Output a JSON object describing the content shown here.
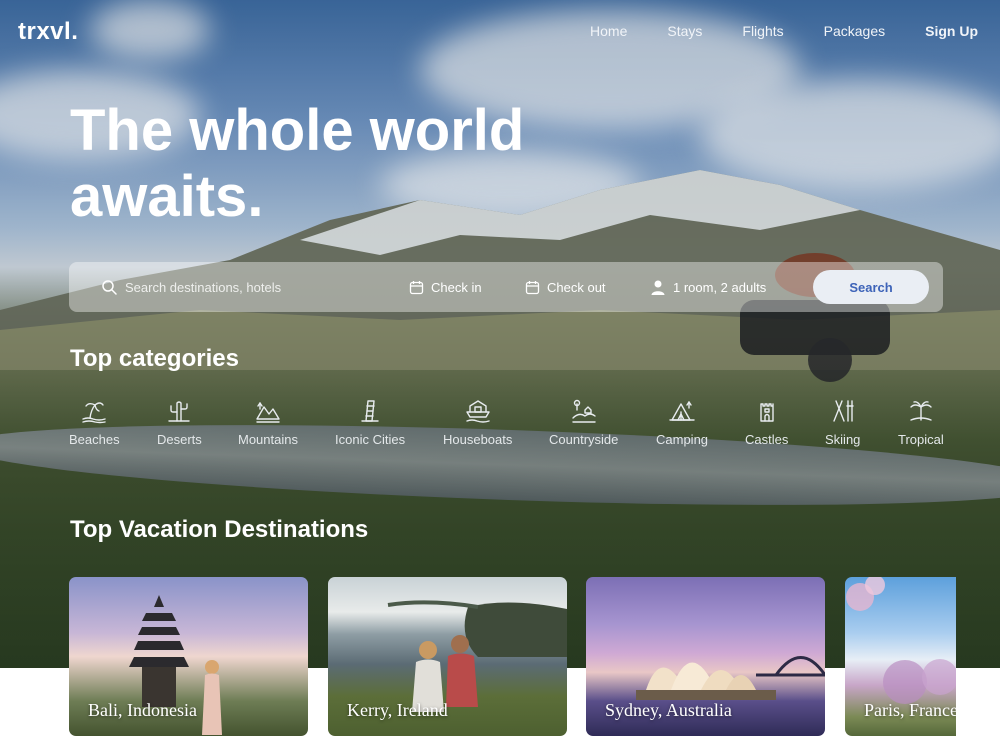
{
  "brand": {
    "logo": "trxvl."
  },
  "nav": {
    "items": [
      "Home",
      "Stays",
      "Flights",
      "Packages"
    ],
    "signup": "Sign Up"
  },
  "hero": {
    "headline": "The whole world awaits."
  },
  "search": {
    "placeholder": "Search destinations, hotels",
    "checkin": "Check in",
    "checkout": "Check out",
    "guests": "1 room, 2 adults",
    "button": "Search"
  },
  "categories": {
    "title": "Top categories",
    "items": [
      {
        "label": "Beaches",
        "icon": "beach-icon"
      },
      {
        "label": "Deserts",
        "icon": "cactus-icon"
      },
      {
        "label": "Mountains",
        "icon": "mountain-icon"
      },
      {
        "label": "Iconic Cities",
        "icon": "leaning-tower-icon"
      },
      {
        "label": "Houseboats",
        "icon": "houseboat-icon"
      },
      {
        "label": "Countryside",
        "icon": "countryside-icon"
      },
      {
        "label": "Camping",
        "icon": "tent-icon"
      },
      {
        "label": "Castles",
        "icon": "castle-icon"
      },
      {
        "label": "Skiing",
        "icon": "ski-icon"
      },
      {
        "label": "Tropical",
        "icon": "palm-tree-icon"
      }
    ]
  },
  "destinations": {
    "title": "Top Vacation Destinations",
    "items": [
      {
        "label": "Bali, Indonesia"
      },
      {
        "label": "Kerry, Ireland"
      },
      {
        "label": "Sydney, Australia"
      },
      {
        "label": "Paris, France"
      }
    ]
  },
  "colors": {
    "accent": "#3d63b8",
    "search_button_bg": "#eaeef4",
    "text_on_hero": "#ffffff"
  }
}
